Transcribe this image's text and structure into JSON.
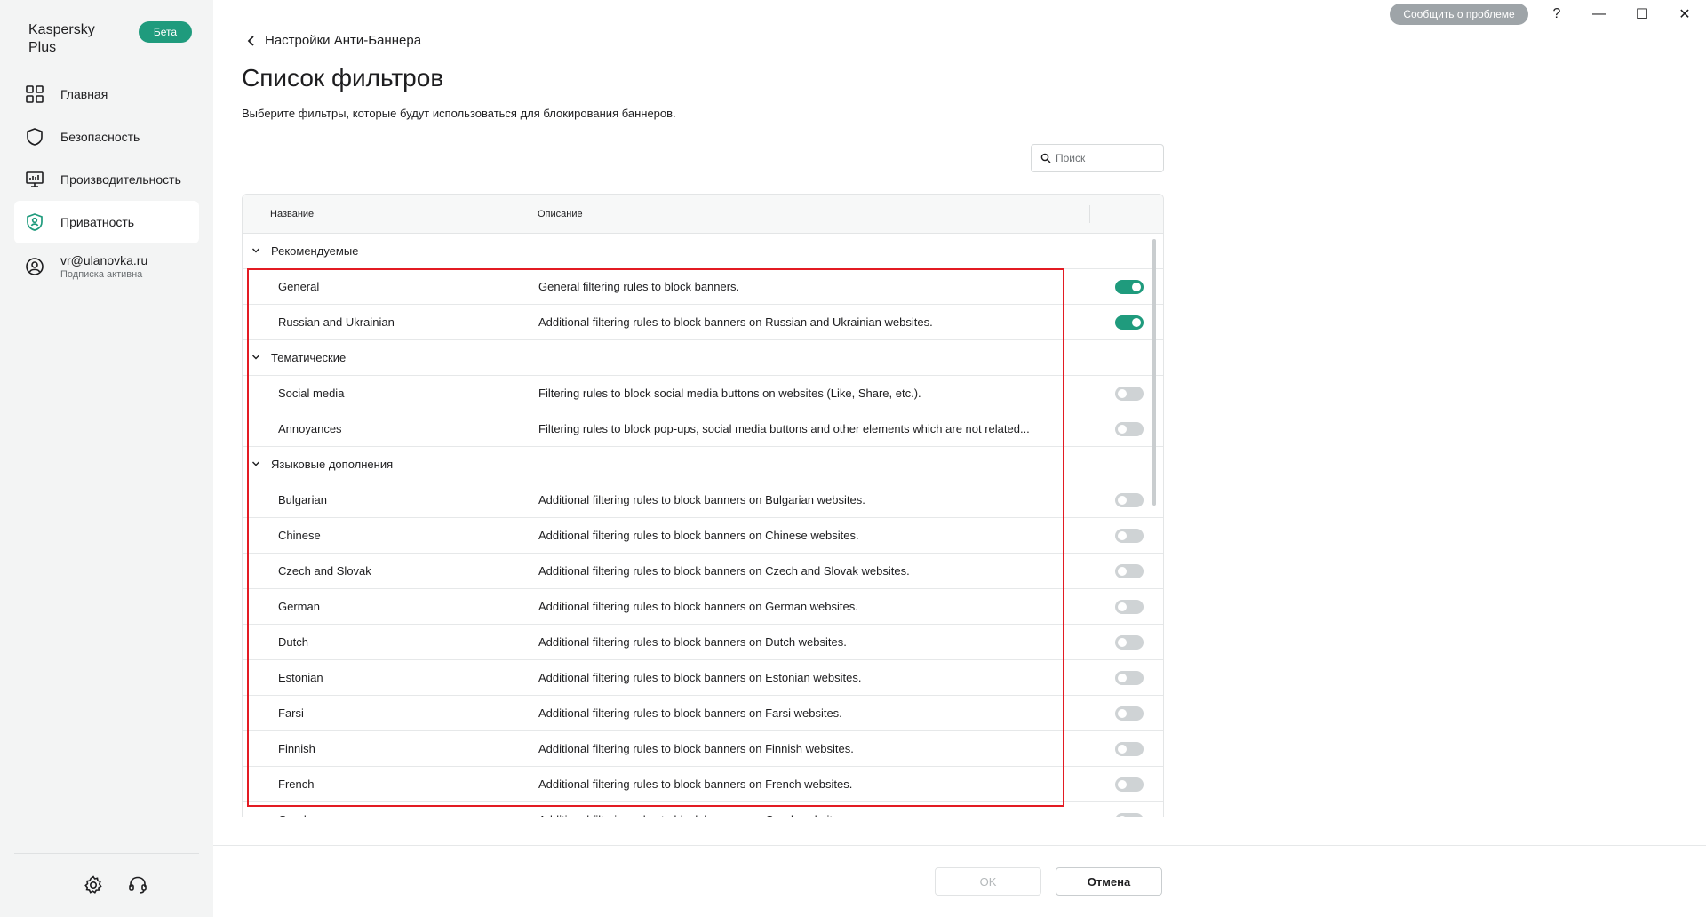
{
  "app": {
    "brand": "Kaspersky Plus",
    "beta_badge": "Бета",
    "report_button": "Сообщить о проблеме",
    "window_controls": {
      "help": "?",
      "minimize": "—",
      "maximize": "☐",
      "close": "✕"
    }
  },
  "sidebar": {
    "items": [
      {
        "label": "Главная",
        "icon": "grid-icon"
      },
      {
        "label": "Безопасность",
        "icon": "shield-icon"
      },
      {
        "label": "Производительность",
        "icon": "monitor-icon"
      },
      {
        "label": "Приватность",
        "icon": "privacy-shield-icon",
        "active": true
      }
    ],
    "account": {
      "email": "vr@ulanovka.ru",
      "status": "Подписка активна"
    }
  },
  "header": {
    "back_label": "Настройки Анти-Баннера",
    "title": "Список фильтров",
    "description": "Выберите фильтры, которые будут использоваться для блокирования баннеров."
  },
  "search": {
    "placeholder": "Поиск",
    "value": ""
  },
  "table": {
    "columns": [
      "Название",
      "Описание"
    ],
    "groups": [
      {
        "name": "Рекомендуемые",
        "rows": [
          {
            "name": "General",
            "desc": "General filtering rules to block banners.",
            "on": true
          },
          {
            "name": "Russian and Ukrainian",
            "desc": "Additional filtering rules to block banners on Russian and Ukrainian websites.",
            "on": true
          }
        ]
      },
      {
        "name": "Тематические",
        "rows": [
          {
            "name": "Social media",
            "desc": "Filtering rules to block social media buttons on websites (Like, Share, etc.).",
            "on": false
          },
          {
            "name": "Annoyances",
            "desc": "Filtering rules to block pop-ups, social media buttons and other elements which are not related...",
            "on": false
          }
        ]
      },
      {
        "name": "Языковые дополнения",
        "rows": [
          {
            "name": "Bulgarian",
            "desc": "Additional filtering rules to block banners on Bulgarian websites.",
            "on": false
          },
          {
            "name": "Chinese",
            "desc": "Additional filtering rules to block banners on Chinese websites.",
            "on": false
          },
          {
            "name": "Czech and Slovak",
            "desc": "Additional filtering rules to block banners on Czech and Slovak websites.",
            "on": false
          },
          {
            "name": "German",
            "desc": "Additional filtering rules to block banners on German websites.",
            "on": false
          },
          {
            "name": "Dutch",
            "desc": "Additional filtering rules to block banners on Dutch websites.",
            "on": false
          },
          {
            "name": "Estonian",
            "desc": "Additional filtering rules to block banners on Estonian websites.",
            "on": false
          },
          {
            "name": "Farsi",
            "desc": "Additional filtering rules to block banners on Farsi websites.",
            "on": false
          },
          {
            "name": "Finnish",
            "desc": "Additional filtering rules to block banners on Finnish websites.",
            "on": false
          },
          {
            "name": "French",
            "desc": "Additional filtering rules to block banners on French websites.",
            "on": false
          },
          {
            "name": "Greek",
            "desc": "Additional filtering rules to block banners on Greek websites.",
            "on": false
          }
        ]
      }
    ]
  },
  "footer": {
    "ok": "OK",
    "cancel": "Отмена"
  },
  "colors": {
    "accent": "#1f9b7d",
    "highlight": "#e31b23",
    "sidebar_bg": "#f3f4f4"
  }
}
